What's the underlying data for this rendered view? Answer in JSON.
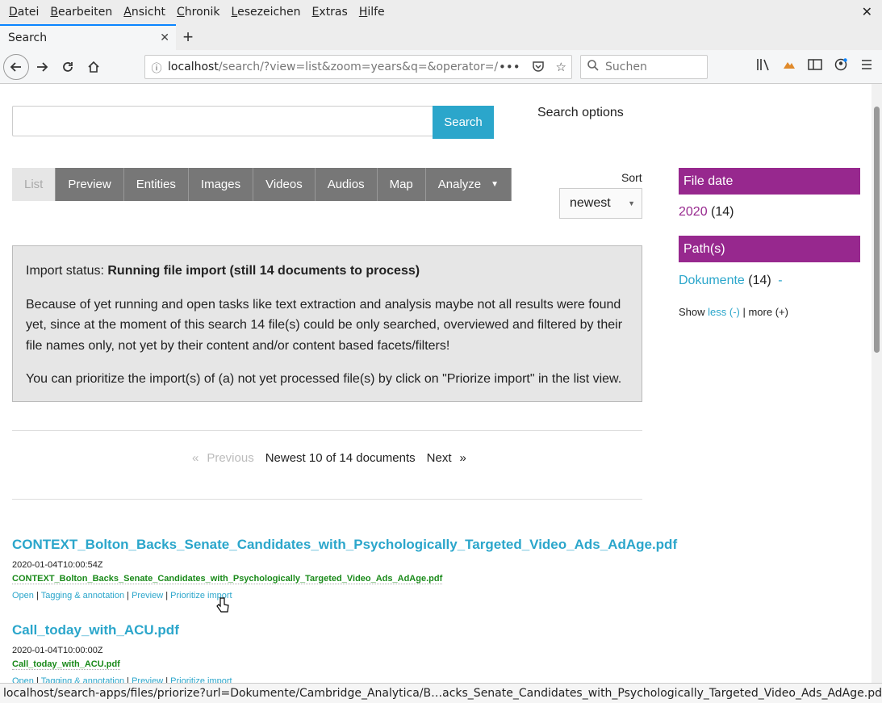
{
  "menu": {
    "items": [
      {
        "first": "D",
        "rest": "atei"
      },
      {
        "first": "B",
        "rest": "earbeiten"
      },
      {
        "first": "A",
        "rest": "nsicht"
      },
      {
        "first": "C",
        "rest": "hronik"
      },
      {
        "first": "L",
        "rest": "esezeichen"
      },
      {
        "first": "E",
        "rest": "xtras"
      },
      {
        "first": "H",
        "rest": "ilfe"
      }
    ],
    "close": "✕"
  },
  "tab": {
    "title": "Search",
    "close": "✕",
    "new": "+"
  },
  "nav": {
    "url_host": "localhost",
    "url_path": "/search/?view=list&zoom=years&q=&operator=/",
    "search_placeholder": "Suchen",
    "icons": [
      "back-icon",
      "forward-icon",
      "reload-icon",
      "home-icon",
      "library-icon",
      "extension-icon",
      "sidebar-icon",
      "account-icon",
      "menu-icon"
    ]
  },
  "search": {
    "button": "Search",
    "options": "Search options"
  },
  "views": {
    "list": "List",
    "preview": "Preview",
    "entities": "Entities",
    "images": "Images",
    "videos": "Videos",
    "audios": "Audios",
    "map": "Map",
    "analyze": "Analyze"
  },
  "sort": {
    "label": "Sort",
    "value": "newest"
  },
  "status": {
    "prefix": "Import status: ",
    "strong": "Running file import (still 14 documents to process)",
    "para2": "Because of yet running and open tasks like text extraction and analysis maybe not all results were found yet, since at the moment of this search 14 file(s) could be only searched, overviewed and filtered by their file names only, not yet by their content and/or content based facets/filters!",
    "para3": "You can prioritize the import(s) of (a) not yet processed file(s) by click on \"Priorize import\" in the list view."
  },
  "pager": {
    "prev_arrow": "«",
    "prev": "Previous",
    "summary": "Newest 10 of 14 documents",
    "next": "Next",
    "next_arrow": "»"
  },
  "results": [
    {
      "title": "CONTEXT_Bolton_Backs_Senate_Candidates_with_Psychologically_Targeted_Video_Ads_AdAge.pdf",
      "date": "2020-01-04T10:00:54Z",
      "file": "CONTEXT_Bolton_Backs_Senate_Candidates_with_Psychologically_Targeted_Video_Ads_AdAge.pdf",
      "links": {
        "open": "Open",
        "tag": "Tagging & annotation",
        "preview": "Preview",
        "prio": "Prioritize import"
      }
    },
    {
      "title": "Call_today_with_ACU.pdf",
      "date": "2020-01-04T10:00:00Z",
      "file": "Call_today_with_ACU.pdf",
      "links": {
        "open": "Open",
        "tag": "Tagging & annotation",
        "preview": "Preview",
        "prio": "Prioritize import"
      }
    }
  ],
  "facets": {
    "date_head": "File date",
    "date_item": "2020",
    "date_count": "(14)",
    "path_head": "Path(s)",
    "path_item": "Dokumente",
    "path_count": "(14)",
    "path_minus": "-",
    "show": "Show ",
    "less": "less (-)",
    "sep": " | ",
    "more": "more (+)"
  },
  "sep": " | ",
  "statusbar": "localhost/search-apps/files/priorize?url=Dokumente/Cambridge_Analytica/B…acks_Senate_Candidates_with_Psychologically_Targeted_Video_Ads_AdAge.pdf",
  "colors": {
    "accent": "#2ba6cb",
    "facet": "#97288e",
    "filegreen": "#1a8a1a"
  }
}
